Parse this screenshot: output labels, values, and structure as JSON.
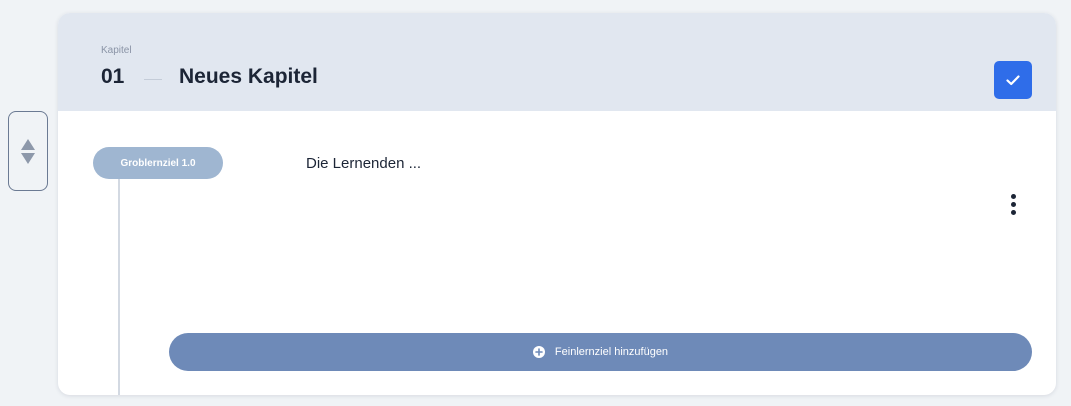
{
  "chapter": {
    "caption": "Kapitel",
    "number": "01",
    "title": "Neues Kapitel",
    "confirm_icon": "checkmark-icon"
  },
  "reorder": {
    "up_icon": "triangle-up-icon",
    "down_icon": "triangle-down-icon"
  },
  "goal": {
    "badge": "Groblernziel 1.0",
    "text": "Die Lernenden ...",
    "menu_icon": "more-vertical-icon"
  },
  "add_button": {
    "label": "Feinlernziel hinzufügen",
    "icon": "plus-circle-icon"
  },
  "colors": {
    "accent": "#2f6de9",
    "header_bg": "#e1e7f0",
    "badge_bg": "#9fb6d1",
    "add_button_bg": "#6e8ab8"
  }
}
